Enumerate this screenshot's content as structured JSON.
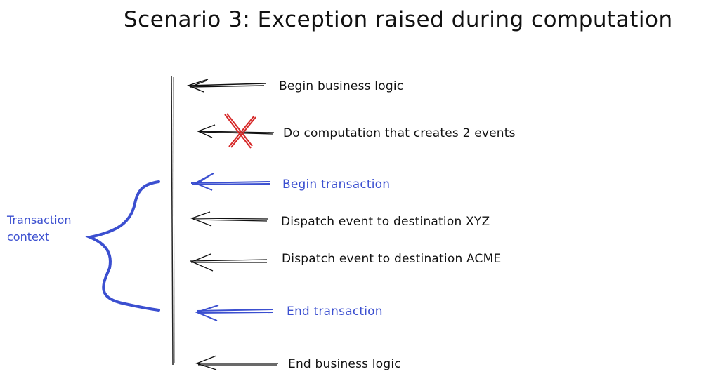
{
  "title": "Scenario 3: Exception raised during computation",
  "context_label": {
    "line1": "Transaction",
    "line2": "context",
    "color": "#3b4fd0"
  },
  "steps": [
    {
      "label": "Begin business logic",
      "color": "#111111"
    },
    {
      "label": "Do computation that creates 2 events",
      "color": "#111111",
      "crossed_out": true
    },
    {
      "label": "Begin transaction",
      "color": "#3b4fd0"
    },
    {
      "label": "Dispatch event to destination XYZ",
      "color": "#111111"
    },
    {
      "label": "Dispatch event to destination ACME",
      "color": "#111111"
    },
    {
      "label": "End transaction",
      "color": "#3b4fd0"
    },
    {
      "label": "End business logic",
      "color": "#111111"
    }
  ],
  "colors": {
    "ink": "#111111",
    "accent_blue": "#3b4fd0",
    "error_red": "#d62828"
  }
}
